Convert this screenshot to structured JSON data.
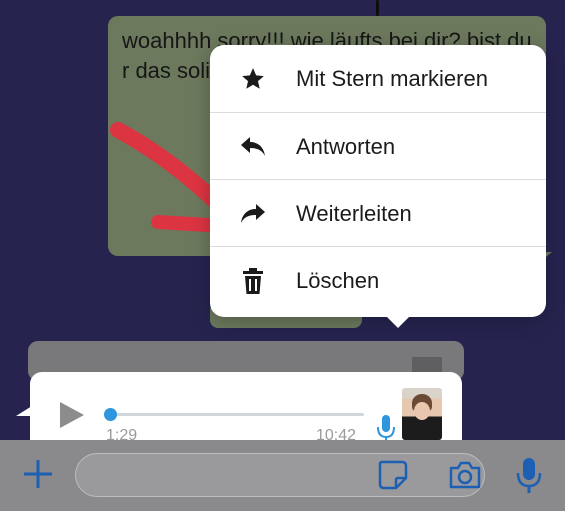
{
  "chat": {
    "outgoing_message": "woahhhh sorry!!! wie läufts bei dir? bist du r das soli corona- verbote heute ic"
  },
  "context_menu": {
    "items": [
      {
        "label": "Mit Stern markieren",
        "icon": "star-icon"
      },
      {
        "label": "Antworten",
        "icon": "reply-icon"
      },
      {
        "label": "Weiterleiten",
        "icon": "forward-icon"
      },
      {
        "label": "Löschen",
        "icon": "trash-icon"
      }
    ]
  },
  "voice_message": {
    "current_time": "1:29",
    "duration": "10:42",
    "progress": 0
  },
  "input_bar": {
    "placeholder": ""
  },
  "colors": {
    "accent": "#2f95dc",
    "background": "#2c2a5a",
    "outgoing_bubble": "#7c8a6a"
  }
}
